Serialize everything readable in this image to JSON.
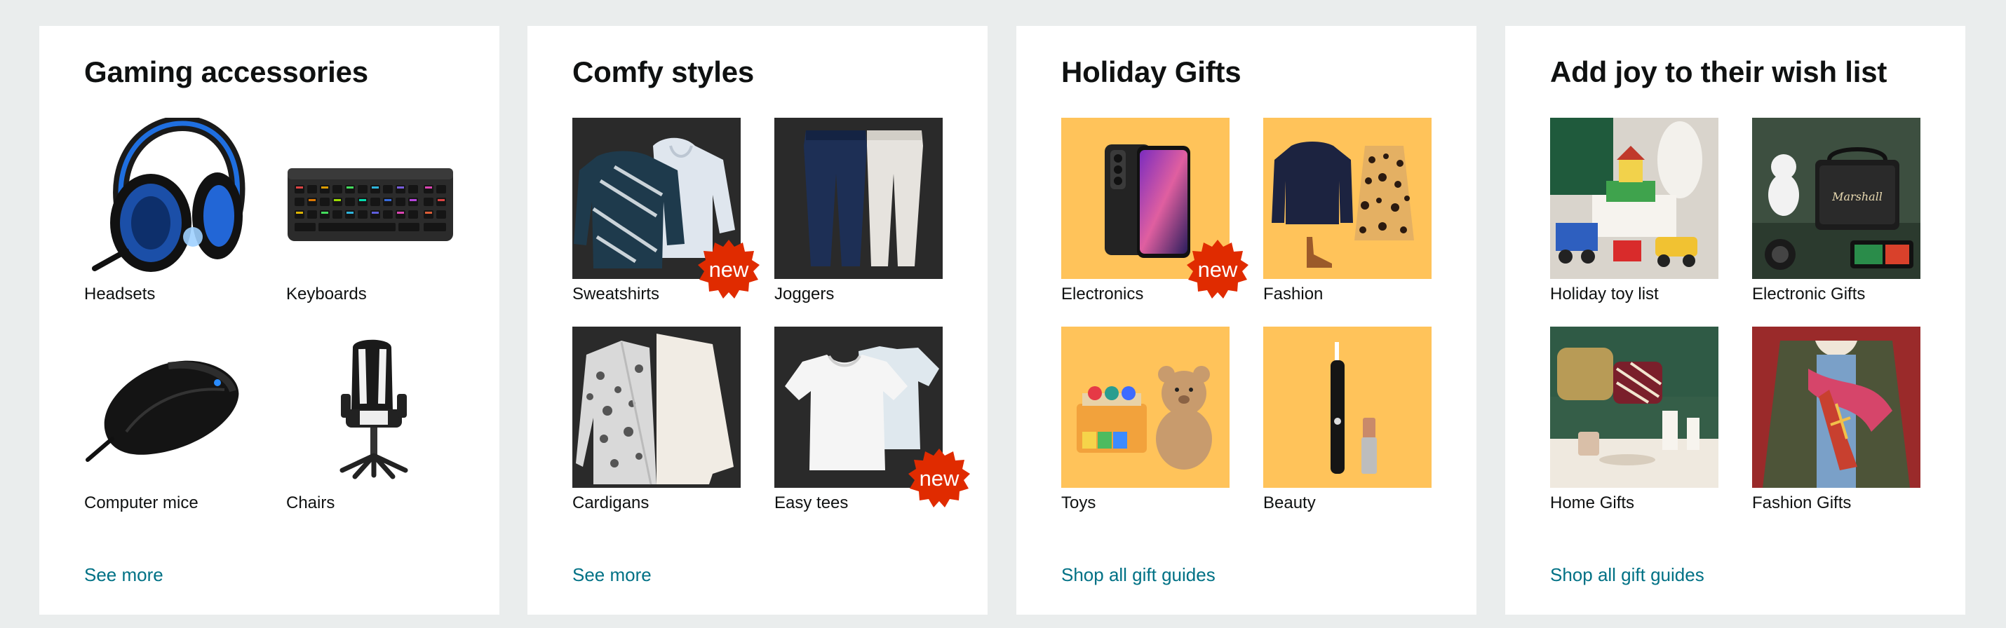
{
  "cards": [
    {
      "title": "Gaming accessories",
      "link": "See more",
      "tiles": [
        {
          "label": "Headsets",
          "icon": "headset-image",
          "badge": ""
        },
        {
          "label": "Keyboards",
          "icon": "keyboard-image",
          "badge": ""
        },
        {
          "label": "Computer mice",
          "icon": "mouse-image",
          "badge": ""
        },
        {
          "label": "Chairs",
          "icon": "gaming-chair-image",
          "badge": ""
        }
      ]
    },
    {
      "title": "Comfy styles",
      "link": "See more",
      "tiles": [
        {
          "label": "Sweatshirts",
          "icon": "sweatshirt-image",
          "badge": "new"
        },
        {
          "label": "Joggers",
          "icon": "joggers-image",
          "badge": ""
        },
        {
          "label": "Cardigans",
          "icon": "cardigan-image",
          "badge": ""
        },
        {
          "label": "Easy tees",
          "icon": "tees-image",
          "badge": "new"
        }
      ]
    },
    {
      "title": "Holiday Gifts",
      "link": "Shop all gift guides",
      "tiles": [
        {
          "label": "Electronics",
          "icon": "smartphone-image",
          "badge": "new"
        },
        {
          "label": "Fashion",
          "icon": "fashion-image",
          "badge": ""
        },
        {
          "label": "Toys",
          "icon": "toys-image",
          "badge": ""
        },
        {
          "label": "Beauty",
          "icon": "beauty-image",
          "badge": ""
        }
      ]
    },
    {
      "title": "Add joy to their wish list",
      "link": "Shop all gift guides",
      "tiles": [
        {
          "label": "Holiday toy list",
          "icon": "toy-set-image",
          "badge": ""
        },
        {
          "label": "Electronic Gifts",
          "icon": "speaker-image",
          "badge": ""
        },
        {
          "label": "Home Gifts",
          "icon": "home-decor-image",
          "badge": ""
        },
        {
          "label": "Fashion Gifts",
          "icon": "jacket-scarf-image",
          "badge": ""
        }
      ]
    }
  ],
  "colors": {
    "page_bg": "#eaeded",
    "card_bg": "#ffffff",
    "link": "#007185",
    "badge": "#e02b00",
    "gift_tile_bg": "#ffc35a",
    "dark_tile_bg": "#2a2a2a"
  }
}
